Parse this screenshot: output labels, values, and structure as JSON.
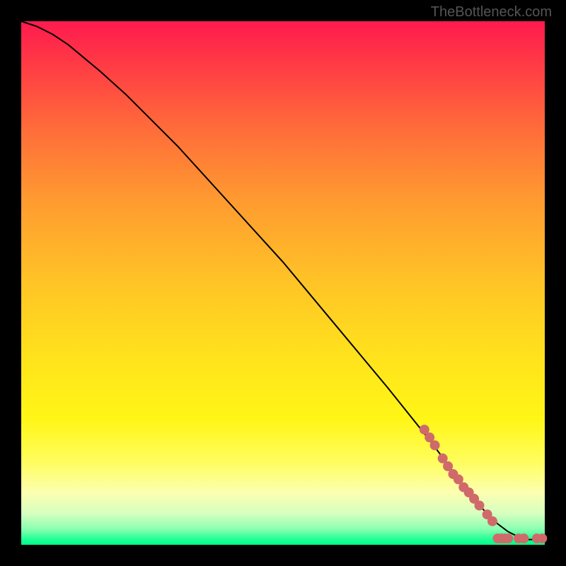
{
  "attribution": "TheBottleneck.com",
  "chart_data": {
    "type": "line",
    "title": "",
    "xlabel": "",
    "ylabel": "",
    "xlim": [
      0,
      100
    ],
    "ylim": [
      0,
      100
    ],
    "grid": false,
    "legend": false,
    "series": [
      {
        "name": "curve",
        "x": [
          0,
          3,
          6,
          9,
          12,
          15,
          20,
          30,
          40,
          50,
          60,
          70,
          78,
          84,
          88,
          91,
          93,
          95,
          97,
          100
        ],
        "y": [
          100,
          99,
          97.5,
          95.5,
          93,
          90.5,
          86,
          76,
          65,
          54,
          42,
          30,
          20,
          12,
          7,
          4,
          2.5,
          1.5,
          1,
          1
        ]
      }
    ],
    "highlight_points": {
      "name": "marker-dots",
      "color": "#d06a6a",
      "points": [
        {
          "x": 77,
          "y": 22
        },
        {
          "x": 78,
          "y": 20.5
        },
        {
          "x": 79,
          "y": 19
        },
        {
          "x": 80.5,
          "y": 16.5
        },
        {
          "x": 81.5,
          "y": 15
        },
        {
          "x": 82.5,
          "y": 13.5
        },
        {
          "x": 83.5,
          "y": 12.5
        },
        {
          "x": 84.5,
          "y": 11
        },
        {
          "x": 85.5,
          "y": 10
        },
        {
          "x": 86.5,
          "y": 8.8
        },
        {
          "x": 87.5,
          "y": 7.5
        },
        {
          "x": 89,
          "y": 5.8
        },
        {
          "x": 90,
          "y": 4.5
        },
        {
          "x": 91,
          "y": 1.2
        },
        {
          "x": 91.7,
          "y": 1.2
        },
        {
          "x": 92.3,
          "y": 1.2
        },
        {
          "x": 93,
          "y": 1.2
        },
        {
          "x": 95,
          "y": 1.2
        },
        {
          "x": 96,
          "y": 1.2
        },
        {
          "x": 98.5,
          "y": 1.2
        },
        {
          "x": 99.5,
          "y": 1.2
        }
      ]
    }
  }
}
